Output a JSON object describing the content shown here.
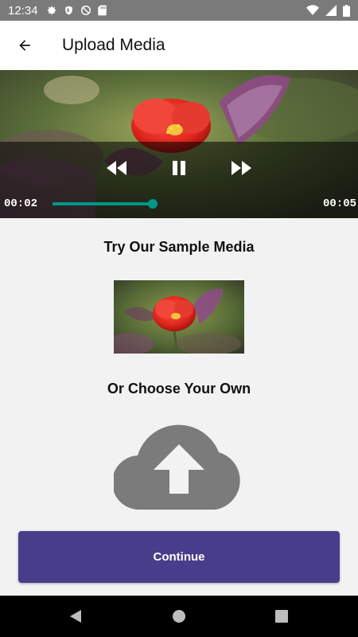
{
  "status_bar": {
    "time": "12:34"
  },
  "app_bar": {
    "title": "Upload Media"
  },
  "player": {
    "current_time": "00:02",
    "duration": "00:05",
    "progress": 0.4
  },
  "sample_section": {
    "title": "Try Our Sample Media"
  },
  "own_section": {
    "title": "Or Choose Your Own"
  },
  "actions": {
    "continue_label": "Continue"
  },
  "colors": {
    "accent_teal": "#009688",
    "button_purple": "#483d8b",
    "cloud_gray": "#7b7b7b"
  },
  "icons": [
    "settings-icon",
    "shield-icon",
    "sync-off-icon",
    "sd-card-icon",
    "wifi-icon",
    "signal-icon",
    "battery-icon",
    "arrow-back-icon",
    "rewind-icon",
    "pause-icon",
    "fast-forward-icon",
    "cloud-upload-icon",
    "nav-back-icon",
    "nav-home-icon",
    "nav-recents-icon"
  ]
}
